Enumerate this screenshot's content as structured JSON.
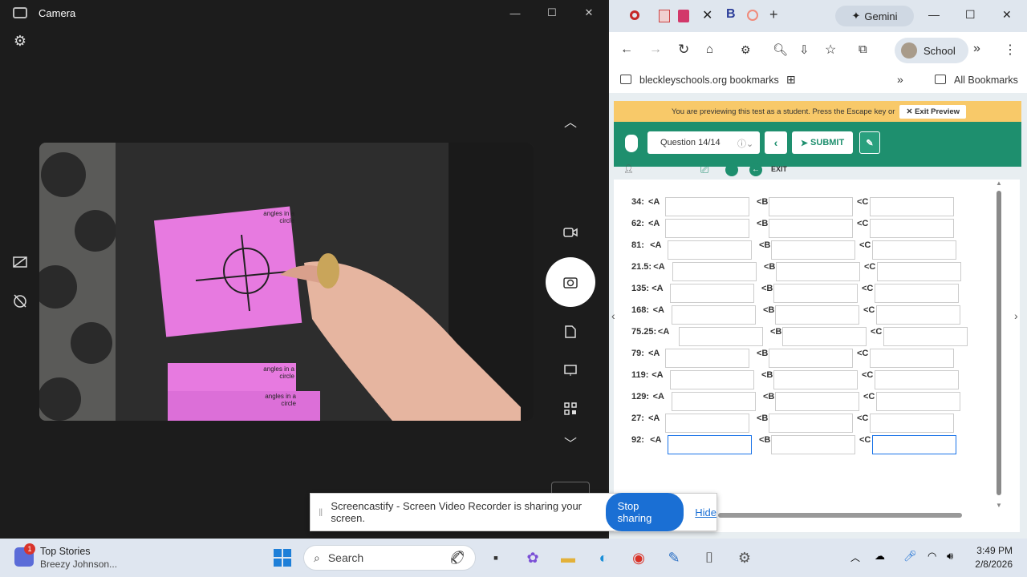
{
  "camera": {
    "title": "Camera",
    "minimize": "—",
    "maximize": "☐",
    "close": "✕"
  },
  "browser": {
    "tabs": [
      "",
      "",
      ""
    ],
    "gemini": "Gemini",
    "profile": "School",
    "bookmarks": {
      "folder": "bleckleyschools.org bookmarks",
      "all": "All Bookmarks"
    },
    "banner": {
      "text": "You are previewing this test as a student. Press the Escape key or",
      "exit": "Exit Preview"
    },
    "question": "Question 14/14",
    "submit": "SUBMIT",
    "exit": "EXIT",
    "rows": [
      {
        "label": "34:",
        "a": "<A",
        "b": "<B",
        "c": "<C"
      },
      {
        "label": "62:",
        "a": "<A",
        "b": "<B",
        "c": "<C"
      },
      {
        "label": "81:",
        "a": "<A",
        "b": "<B",
        "c": "<C"
      },
      {
        "label": "21.5:",
        "a": "<A",
        "b": "<B",
        "c": "<C"
      },
      {
        "label": "135:",
        "a": "<A",
        "b": "<B",
        "c": "<C"
      },
      {
        "label": "168:",
        "a": "<A",
        "b": "<B",
        "c": "<C"
      },
      {
        "label": "75.25:",
        "a": "<A",
        "b": "<B",
        "c": "<C"
      },
      {
        "label": "79:",
        "a": "<A",
        "b": "<B",
        "c": "<C"
      },
      {
        "label": "119:",
        "a": "<A",
        "b": "<B",
        "c": "<C"
      },
      {
        "label": "129:",
        "a": "<A",
        "b": "<B",
        "c": "<C"
      },
      {
        "label": "27:",
        "a": "<A",
        "b": "<B",
        "c": "<C"
      },
      {
        "label": "92:",
        "a": "<A",
        "b": "<B",
        "c": "<C"
      }
    ]
  },
  "card_text": "angles in a circle",
  "share": {
    "text": "Screencastify - Screen Video Recorder is sharing your screen.",
    "stop": "Stop sharing",
    "hide": "Hide"
  },
  "taskbar": {
    "news_title": "Top Stories",
    "news_sub": "Breezy Johnson...",
    "badge": "1",
    "search": "Search",
    "time": "3:49 PM",
    "date": "2/8/2026"
  }
}
